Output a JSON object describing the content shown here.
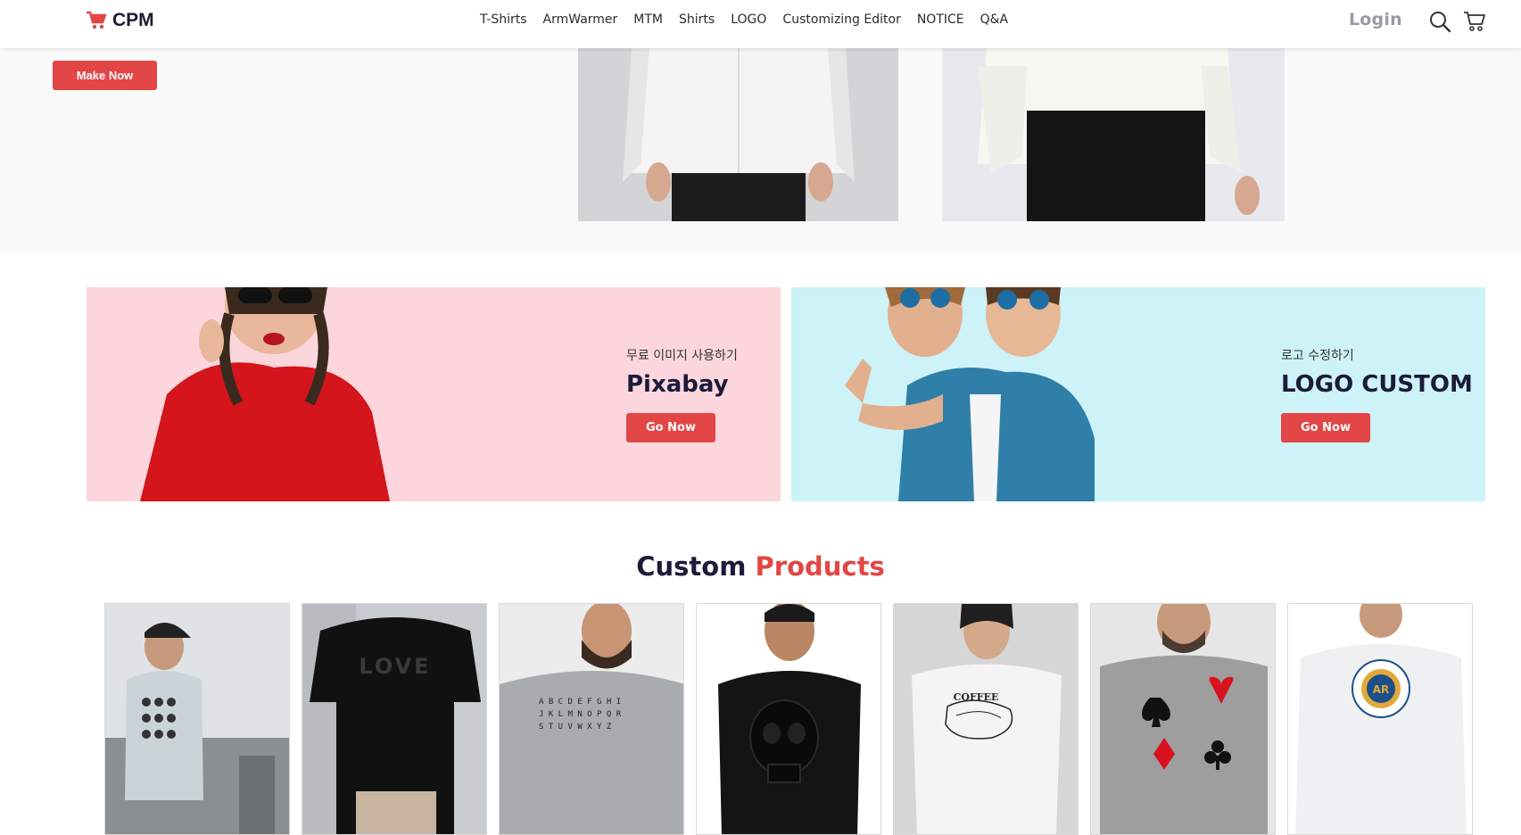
{
  "header": {
    "brand": "CPM",
    "nav": [
      "T-Shirts",
      "ArmWarmer",
      "MTM",
      "Shirts",
      "LOGO",
      "Customizing Editor",
      "NOTICE",
      "Q&A"
    ],
    "login": "Login",
    "icons": [
      "search-icon",
      "cart-icon"
    ]
  },
  "hero": {
    "button": "Make Now"
  },
  "promos": [
    {
      "subtitle": "무료 이미지 사용하기",
      "title": "Pixabay",
      "button": "Go Now",
      "bg": "#fcd6dc"
    },
    {
      "subtitle": "로고 수정하기",
      "title": "LOGO CUSTOM",
      "button": "Go Now",
      "bg": "#cdf2f8"
    }
  ],
  "section": {
    "title_dark": "Custom",
    "title_accent": "Products"
  },
  "products": [
    {
      "print": "skulls-grid"
    },
    {
      "print": "LOVE"
    },
    {
      "print": "ABCDEFGHI JKLMNOPQR STUVWXYZ"
    },
    {
      "print": "skull"
    },
    {
      "print": "COFFEE"
    },
    {
      "print": "card-suits"
    },
    {
      "print": "emblem"
    }
  ],
  "colors": {
    "accent": "#e24646",
    "navy": "#1b1b3a"
  }
}
